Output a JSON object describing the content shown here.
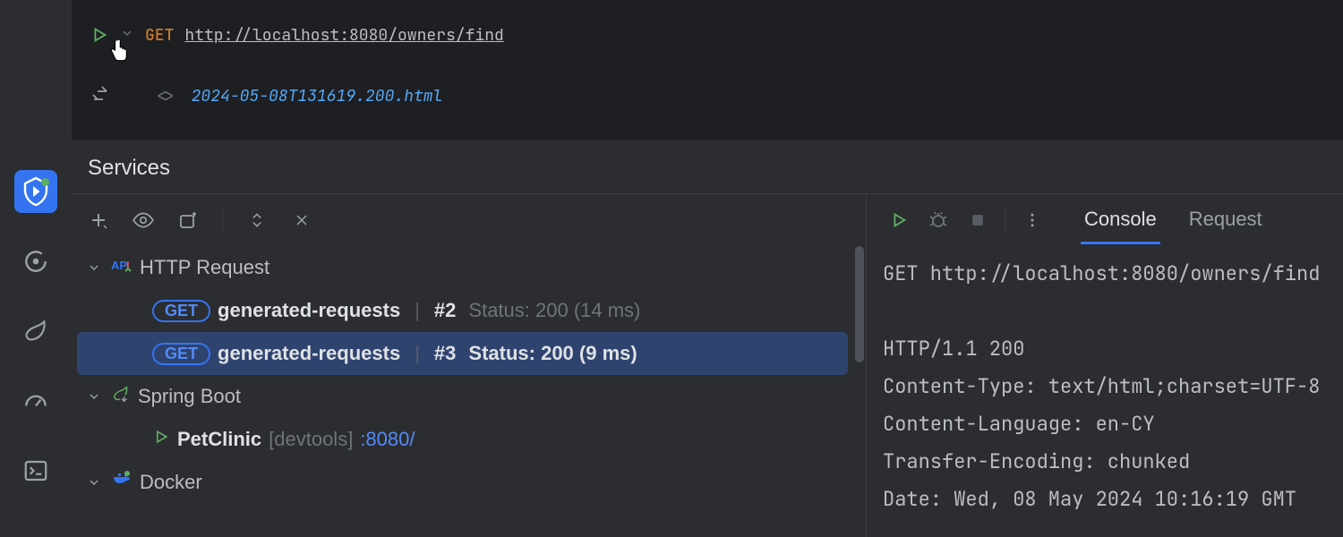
{
  "editor": {
    "method": "GET",
    "url": "http://localhost:8080/owners/find",
    "response_file": "2024-05-08T131619.200.html"
  },
  "panel_title": "Services",
  "tree": {
    "http_label": "HTTP Request",
    "requests": [
      {
        "method": "GET",
        "name": "generated-requests",
        "num": "#2",
        "status": "Status: 200 (14 ms)",
        "selected": false
      },
      {
        "method": "GET",
        "name": "generated-requests",
        "num": "#3",
        "status": "Status: 200 (9 ms)",
        "selected": true
      }
    ],
    "spring_label": "Spring Boot",
    "spring_app": "PetClinic",
    "spring_profile": "[devtools]",
    "spring_port": ":8080/",
    "docker_label": "Docker"
  },
  "tabs": {
    "console": "Console",
    "request": "Request"
  },
  "console": {
    "line1": "GET http://localhost:8080/owners/find",
    "line2": "",
    "line3": "HTTP/1.1 200",
    "line4": "Content-Type: text/html;charset=UTF-8",
    "line5": "Content-Language: en-CY",
    "line6": "Transfer-Encoding: chunked",
    "line7": "Date: Wed, 08 May 2024 10:16:19 GMT"
  }
}
